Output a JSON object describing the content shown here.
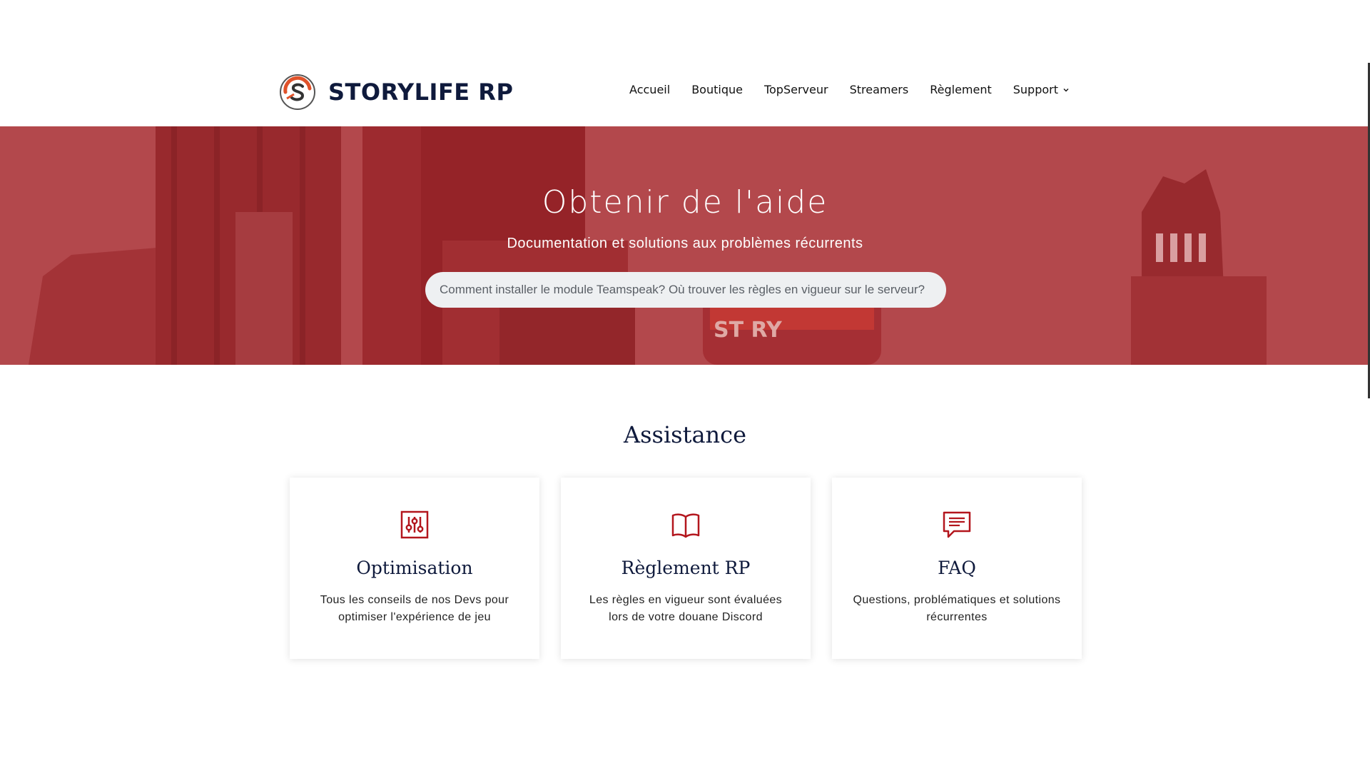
{
  "header": {
    "logo_text": "STORYLIFE RP",
    "nav": {
      "items": [
        {
          "label": "Accueil"
        },
        {
          "label": "Boutique"
        },
        {
          "label": "TopServeur"
        },
        {
          "label": "Streamers"
        },
        {
          "label": "Règlement"
        },
        {
          "label": "Support",
          "has_dropdown": true,
          "icon": "chevron-down-icon"
        }
      ]
    }
  },
  "hero": {
    "title": "Obtenir de l'aide",
    "subtitle": "Documentation et solutions aux problèmes récurrents",
    "search_placeholder": "Comment installer le module Teamspeak? Où trouver les règles en vigueur sur le serveur?"
  },
  "assistance": {
    "title": "Assistance",
    "cards": [
      {
        "icon": "sliders-icon",
        "title": "Optimisation",
        "description": "Tous les conseils de nos Devs pour optimiser l'expérience de jeu"
      },
      {
        "icon": "book-icon",
        "title": "Règlement RP",
        "description": "Les règles en vigueur sont évaluées lors de votre douane Discord"
      },
      {
        "icon": "chat-icon",
        "title": "FAQ",
        "description": "Questions, problématiques et solutions récurrentes"
      }
    ]
  },
  "colors": {
    "accent": "#b3161d",
    "hero_overlay": "#b3484d",
    "heading": "#0f1a3c"
  }
}
